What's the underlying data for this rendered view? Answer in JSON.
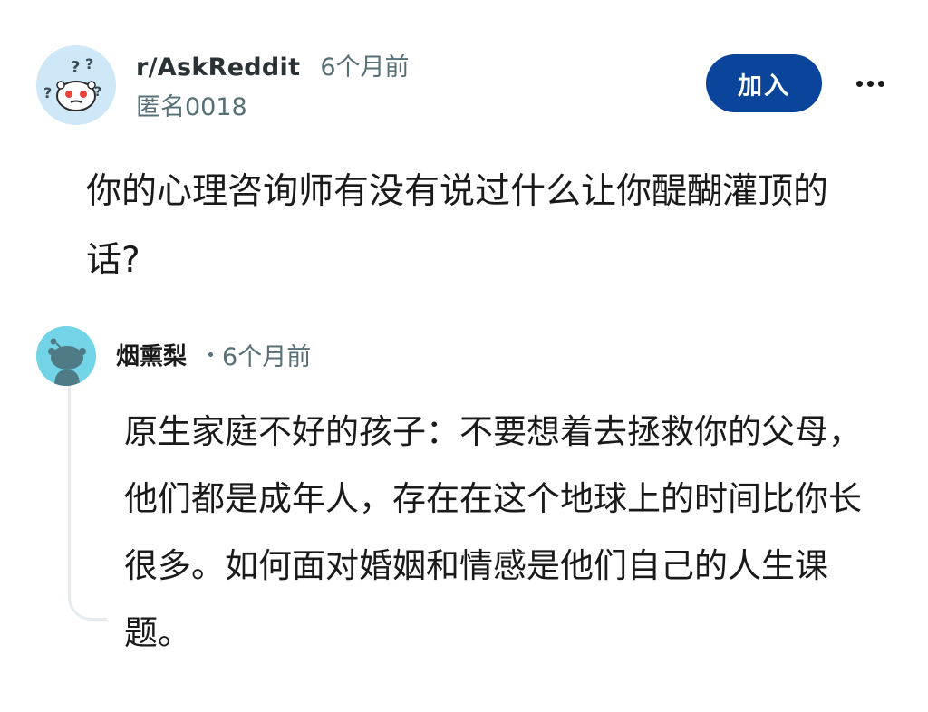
{
  "post": {
    "subreddit": "r/AskReddit",
    "time_ago": "6个月前",
    "author": "匿名0018",
    "join_label": "加入",
    "more_icon": "ellipsis-icon",
    "subreddit_avatar_icon": "reddit-snoo-confused-icon",
    "title": "你的心理咨询师有没有说过什么让你醍醐灌顶的话?"
  },
  "comment": {
    "author": "烟熏梨",
    "time_ago": "6个月前",
    "avatar_icon": "reddit-snoo-default-icon",
    "body": "原生家庭不好的孩子：不要想着去拯救你的父母，他们都是成年人，存在在这个地球上的时间比你长很多。如何面对婚姻和情感是他们自己的人生课题。"
  },
  "colors": {
    "join_button": "#0a449b",
    "meta_text": "#576f76",
    "subreddit_avatar_bg": "#cfe8f8",
    "commenter_avatar_bg": "#73d3e7",
    "thread_line": "#e5ebee"
  }
}
